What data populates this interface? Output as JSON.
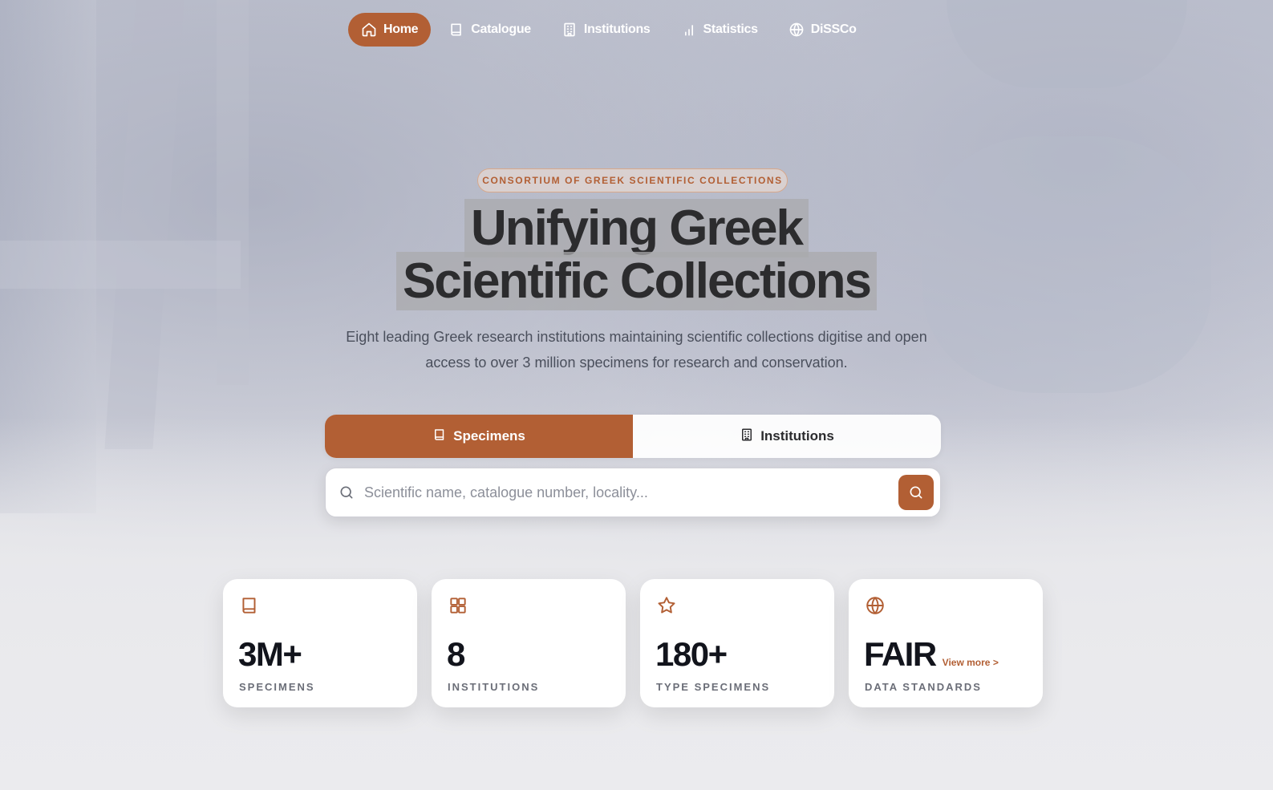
{
  "nav": {
    "items": [
      {
        "label": "Home",
        "icon": "home-icon",
        "active": true
      },
      {
        "label": "Catalogue",
        "icon": "book-icon",
        "active": false
      },
      {
        "label": "Institutions",
        "icon": "building-icon",
        "active": false
      },
      {
        "label": "Statistics",
        "icon": "bar-chart-icon",
        "active": false
      },
      {
        "label": "DiSSCo",
        "icon": "globe-icon",
        "active": false
      }
    ]
  },
  "hero": {
    "badge": "CONSORTIUM OF GREEK SCIENTIFIC COLLECTIONS",
    "title_line1": "Unifying Greek",
    "title_line2": "Scientific Collections",
    "subtitle": "Eight leading Greek research institutions maintaining scientific collections digitise and open access to over 3 million specimens for research and conservation."
  },
  "search": {
    "tabs": [
      {
        "label": "Specimens",
        "icon": "book-icon",
        "active": true
      },
      {
        "label": "Institutions",
        "icon": "building-icon",
        "active": false
      }
    ],
    "value": "",
    "placeholder": "Scientific name, catalogue number, locality..."
  },
  "stats": [
    {
      "value": "3M+",
      "label": "SPECIMENS",
      "icon": "book-icon"
    },
    {
      "value": "8",
      "label": "INSTITUTIONS",
      "icon": "grid-icon"
    },
    {
      "value": "180+",
      "label": "TYPE SPECIMENS",
      "icon": "star-icon"
    },
    {
      "value": "FAIR",
      "label": "DATA STANDARDS",
      "icon": "globe-icon",
      "link": "View more >"
    }
  ],
  "colors": {
    "accent": "#b25f34",
    "text_dark": "#12141c",
    "muted": "#6b6e78"
  }
}
